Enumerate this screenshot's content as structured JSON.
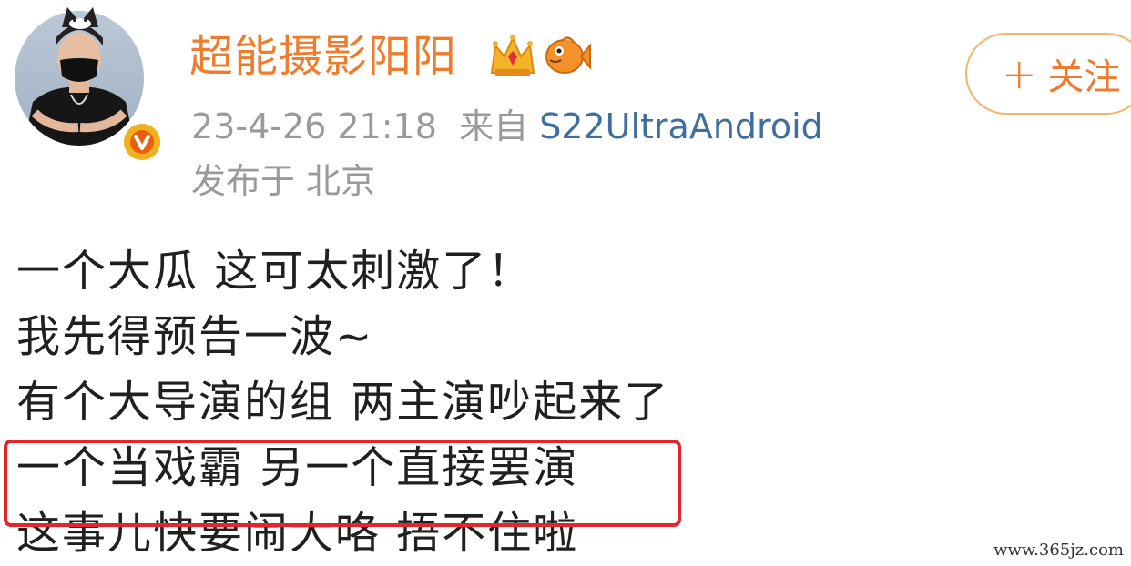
{
  "user": {
    "name": "超能摄影阳阳",
    "verified_badge": "verified-v-icon",
    "badges": [
      "crown-icon",
      "fish-icon"
    ]
  },
  "meta": {
    "time": "23-4-26 21:18",
    "from_label": "来自",
    "device": "S22UltraAndroid",
    "location": "发布于 北京"
  },
  "follow": {
    "plus": "+",
    "label": "关注"
  },
  "post": {
    "lines": [
      "一个大瓜  这可太刺激了！",
      "我先得预告一波~",
      "有个大导演的组 两主演吵起来了",
      "一个当戏霸 另一个直接罢演",
      "这事儿快要闹大咯 捂不住啦"
    ],
    "highlighted_line_index": 3
  },
  "watermark": "www.365jz.com",
  "colors": {
    "username": "#ef7b2c",
    "meta": "#9a9a9a",
    "device": "#3f6f9f",
    "highlight_border": "#e4252c",
    "follow_border": "#f1b66a"
  }
}
